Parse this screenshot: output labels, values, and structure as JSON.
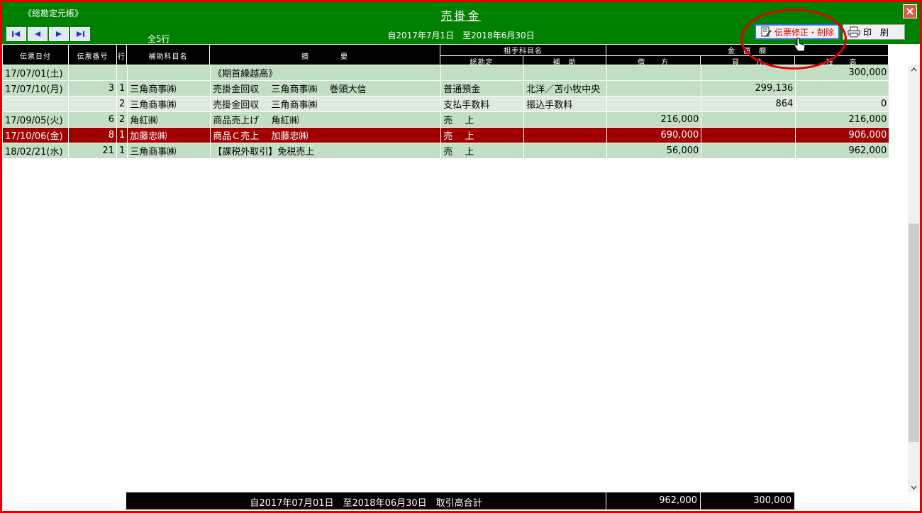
{
  "header": {
    "app_title": "《総勘定元帳》",
    "page_title": "売掛金",
    "row_count": "全5行",
    "period": "自2017年7月1日　至2018年6月30日",
    "edit_button": "伝票修正・削除",
    "print_button": "印 刷"
  },
  "columns": {
    "date": "伝票日付",
    "voucher_no": "伝票番号",
    "line": "行",
    "sub_account": "補助科目名",
    "description": "摘　　　　要",
    "counter_account": "相手科目名",
    "counter_main": "総勘定",
    "counter_sub": "補　助",
    "amount": "金　額　欄",
    "debit": "借　　方",
    "credit": "貸　　方",
    "balance": "残　　高"
  },
  "rows": [
    {
      "date": "17/07/01(土)",
      "no": "",
      "line": "",
      "sub": "",
      "desc": "《期首繰越高》",
      "account": "",
      "account_sub": "",
      "debit": "",
      "credit": "",
      "balance": "300,000",
      "style": "odd"
    },
    {
      "date": "17/07/10(月)",
      "no": "3",
      "line": "1",
      "sub": "三角商事㈱",
      "desc": "売掛金回収　 三角商事㈱　 巻頭大信",
      "account": "普通預金",
      "account_sub": "北洋／苫小牧中央",
      "debit": "",
      "credit": "299,136",
      "balance": "",
      "style": "odd"
    },
    {
      "date": "",
      "no": "",
      "line": "2",
      "sub": "三角商事㈱",
      "desc": "売掛金回収　 三角商事㈱",
      "account": "支払手数料",
      "account_sub": "振込手数料",
      "debit": "",
      "credit": "864",
      "balance": "0",
      "style": "even"
    },
    {
      "date": "17/09/05(火)",
      "no": "6",
      "line": "2",
      "sub": "角紅㈱",
      "desc": "商品売上げ　 角紅㈱",
      "account": "売　 上",
      "account_sub": "",
      "debit": "216,000",
      "credit": "",
      "balance": "216,000",
      "style": "odd"
    },
    {
      "date": "17/10/06(金)",
      "no": "8",
      "line": "1",
      "sub": "加藤忠㈱",
      "desc": "商品Ｃ売上　 加藤忠㈱",
      "account": "売　 上",
      "account_sub": "",
      "debit": "690,000",
      "credit": "",
      "balance": "906,000",
      "style": "sel"
    },
    {
      "date": "18/02/21(水)",
      "no": "21",
      "line": "1",
      "sub": "三角商事㈱",
      "desc": "【課税外取引】免税売上",
      "account": "売　 上",
      "account_sub": "",
      "debit": "56,000",
      "credit": "",
      "balance": "962,000",
      "style": "odd"
    }
  ],
  "footer": {
    "period_total": "自2017年07月01日　至2018年06月30日　取引高合計",
    "debit_total": "962,000",
    "credit_total": "300,000"
  }
}
